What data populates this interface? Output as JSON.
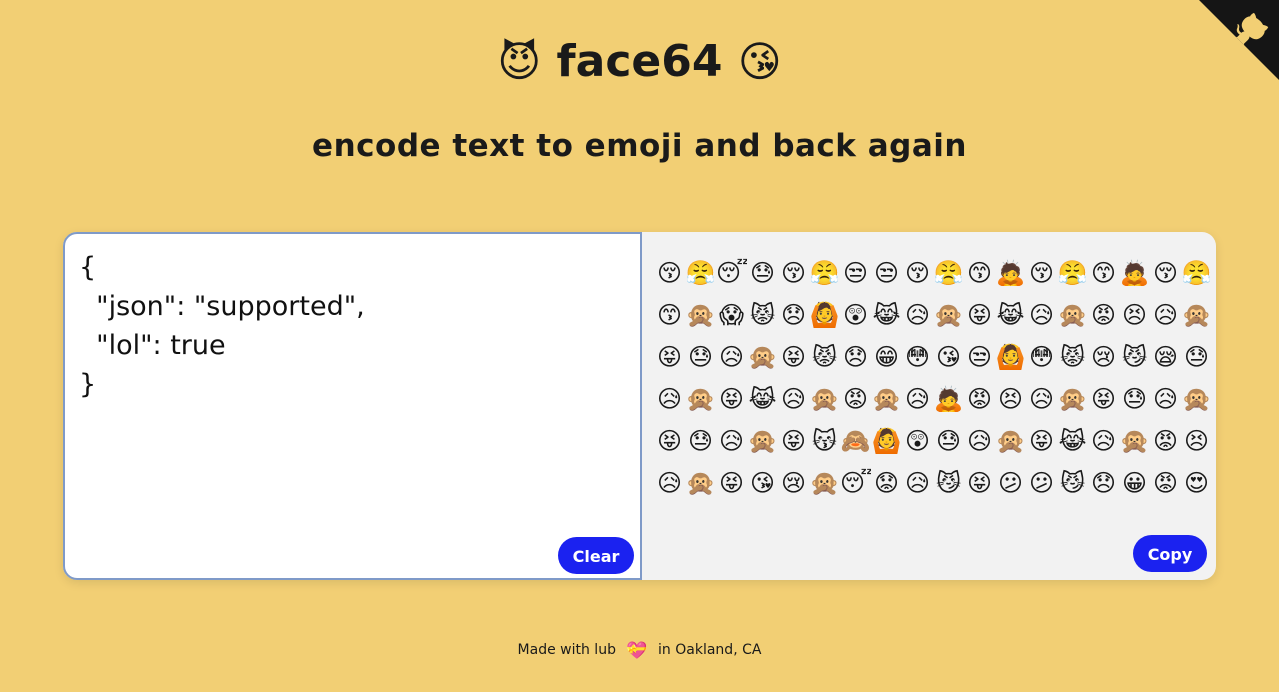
{
  "header": {
    "left_emoji": "😈",
    "title": "face64",
    "right_emoji": "😘",
    "subtitle": "encode text to emoji and back again"
  },
  "input": {
    "value": "{\n  \"json\": \"supported\",\n  \"lol\": true\n}"
  },
  "output": {
    "emojis": [
      "😚",
      "😤",
      "😴",
      "😓",
      "😚",
      "😤",
      "😒",
      "😒",
      "😚",
      "😤",
      "😙",
      "🙇",
      "😚",
      "😤",
      "😙",
      "🙇",
      "😚",
      "😤",
      "😙",
      "🙊",
      "😱",
      "😾",
      "😞",
      "🙆",
      "😲",
      "😹",
      "😥",
      "🙊",
      "😝",
      "😹",
      "😥",
      "🙊",
      "😡",
      "😣",
      "😥",
      "🙊",
      "😝",
      "😓",
      "😥",
      "🙊",
      "😝",
      "😾",
      "😞",
      "😁",
      "😳",
      "😘",
      "😒",
      "🙆",
      "😳",
      "😾",
      "😢",
      "😼",
      "😪",
      "😓",
      "😥",
      "🙊",
      "😝",
      "😹",
      "😥",
      "🙊",
      "😡",
      "🙊",
      "😥",
      "🙇",
      "😡",
      "😣",
      "😥",
      "🙊",
      "😝",
      "😓",
      "😥",
      "🙊",
      "😝",
      "😓",
      "😥",
      "🙊",
      "😝",
      "😽",
      "🙈",
      "🙆",
      "😲",
      "😓",
      "😥",
      "🙊",
      "😝",
      "😹",
      "😥",
      "🙊",
      "😡",
      "😣",
      "😥",
      "🙊",
      "😝",
      "😘",
      "😢",
      "🙊",
      "😴",
      "😟",
      "😥",
      "😼",
      "😝",
      "😕",
      "😕",
      "😼",
      "😞",
      "😀",
      "😡",
      "😍"
    ]
  },
  "buttons": {
    "clear": "Clear",
    "copy": "Copy"
  },
  "footer": {
    "prefix": "Made with lub",
    "heart": "💝",
    "suffix": "in Oakland, CA"
  },
  "colors": {
    "background": "#f2cf74",
    "button": "#1b22f0",
    "corner": "#151515"
  },
  "icons": {
    "corner": "github-octocat-icon"
  }
}
